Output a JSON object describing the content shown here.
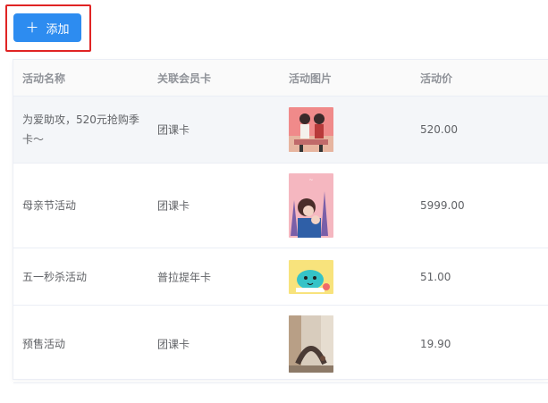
{
  "toolbar": {
    "add_label": "添加"
  },
  "table": {
    "headers": [
      "活动名称",
      "关联会员卡",
      "活动图片",
      "活动价"
    ],
    "rows": [
      {
        "name": "为爱助攻，520元抢购季卡～",
        "card": "团课卡",
        "image": "couple-illustration",
        "price": "520.00"
      },
      {
        "name": "母亲节活动",
        "card": "团课卡",
        "image": "mother-child-illustration",
        "price": "5999.00"
      },
      {
        "name": "五一秒杀活动",
        "card": "普拉提年卡",
        "image": "cartoon-character-illustration",
        "price": "51.00"
      },
      {
        "name": "预售活动",
        "card": "团课卡",
        "image": "yoga-backbend-photo",
        "price": "19.90"
      }
    ]
  },
  "colors": {
    "primary": "#2d8cf0",
    "highlight": "#e02424"
  }
}
